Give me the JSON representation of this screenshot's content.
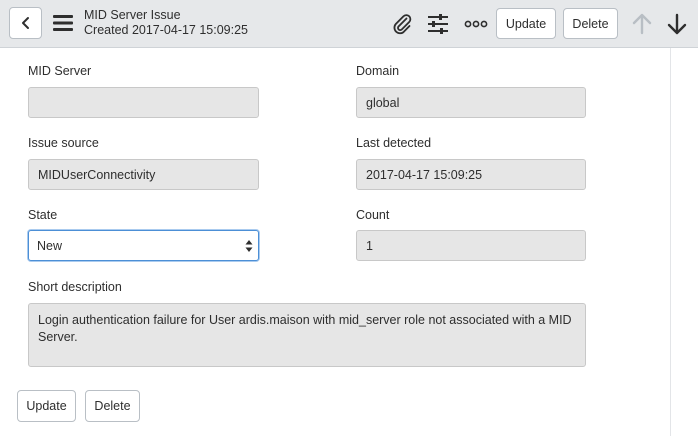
{
  "header": {
    "title": "MID Server Issue",
    "subtitle": "Created 2017-04-17 15:09:25",
    "update_label": "Update",
    "delete_label": "Delete",
    "icons": [
      "back-icon",
      "menu-icon",
      "paperclip-icon",
      "sliders-icon",
      "more-icon",
      "arrow-up-icon",
      "arrow-down-icon"
    ]
  },
  "form": {
    "mid_server": {
      "label": "MID Server",
      "value": ""
    },
    "domain": {
      "label": "Domain",
      "value": "global"
    },
    "issue_source": {
      "label": "Issue source",
      "value": "MIDUserConnectivity"
    },
    "last_detected": {
      "label": "Last detected",
      "value": "2017-04-17 15:09:25"
    },
    "state": {
      "label": "State",
      "value": "New"
    },
    "count": {
      "label": "Count",
      "value": "1"
    },
    "short_description": {
      "label": "Short description",
      "value": "Login authentication failure for User ardis.maison with mid_server role not associated with a MID Server."
    }
  },
  "footer": {
    "update_label": "Update",
    "delete_label": "Delete"
  },
  "colors": {
    "header_bg": "#e6e8ea",
    "field_bg": "#e6e6e6",
    "focus_border": "#4c8fd6",
    "disabled_arrow": "#b8bec4"
  }
}
